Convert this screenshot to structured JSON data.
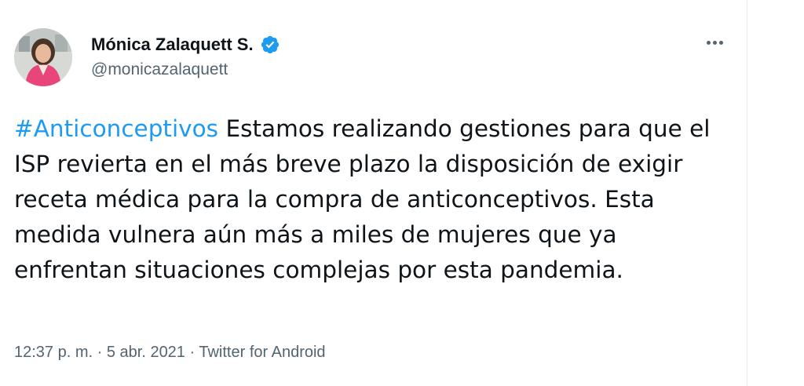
{
  "author": {
    "name": "Mónica Zalaquett S.",
    "handle": "@monicazalaquett",
    "verified": true
  },
  "tweet": {
    "hashtag": "#Anticonceptivos",
    "text": " Estamos realizando gestiones para que el ISP revierta en el más breve plazo la disposición de exigir receta médica para la compra de anticonceptivos. Esta medida vulnera aún más a miles de mujeres que ya enfrentan situaciones complejas por esta pandemia.",
    "time": "12:37 p. m.",
    "separator": " · ",
    "date": "5 abr. 2021",
    "source": "Twitter for Android"
  },
  "icons": {
    "verified": "verified-badge-icon",
    "more": "more-options-icon"
  },
  "colors": {
    "link": "#1d9bf0",
    "text": "#0f1419",
    "secondary": "#536471",
    "avatar_jacket": "#e8457a"
  }
}
